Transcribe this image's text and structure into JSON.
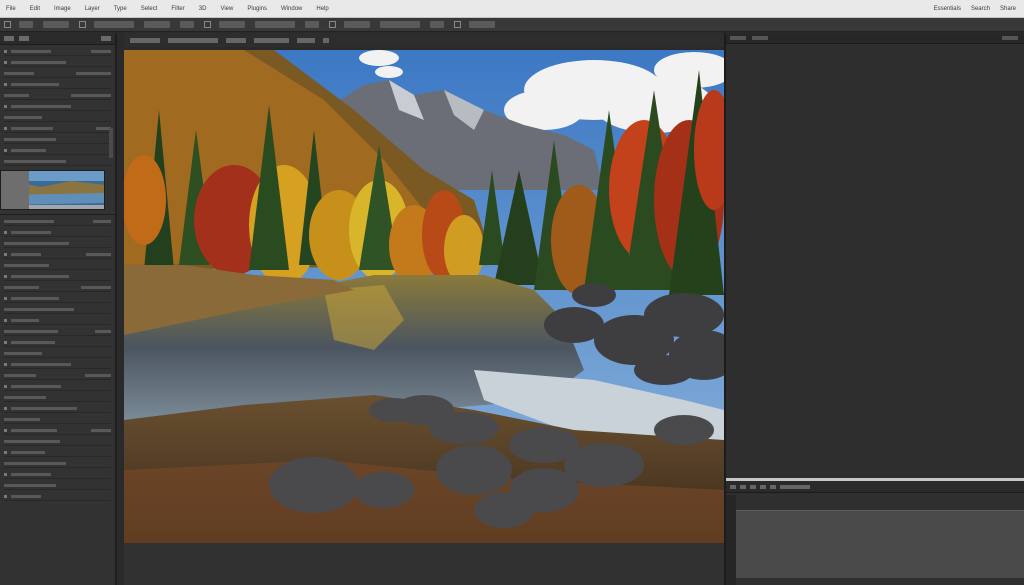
{
  "menubar": {
    "items": [
      "File",
      "Edit",
      "Image",
      "Layer",
      "Type",
      "Select",
      "Filter",
      "3D",
      "View",
      "Plugins",
      "Window",
      "Help"
    ],
    "right_items": [
      "Essentials",
      "Search",
      "Share"
    ]
  },
  "canvas": {
    "image_icon": "landscape-photo"
  },
  "colors": {
    "menubar_bg": "#e9e9e9",
    "panel_bg": "#323232",
    "app_bg": "#2a2a2a"
  }
}
